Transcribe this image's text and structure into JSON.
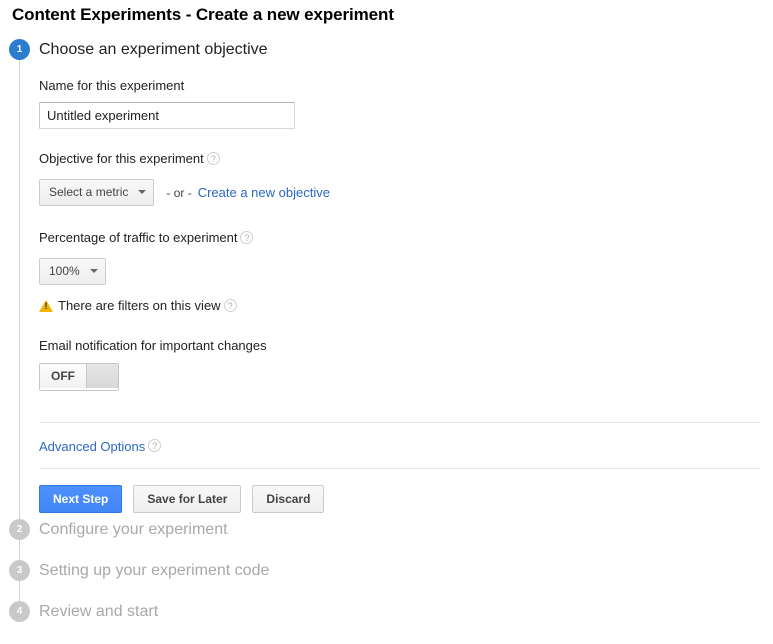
{
  "page": {
    "title": "Content Experiments - Create a new experiment"
  },
  "steps": [
    {
      "number": "1",
      "label": "Choose an experiment objective",
      "state": "active"
    },
    {
      "number": "2",
      "label": "Configure your experiment",
      "state": "inactive"
    },
    {
      "number": "3",
      "label": "Setting up your experiment code",
      "state": "inactive"
    },
    {
      "number": "4",
      "label": "Review and start",
      "state": "inactive"
    }
  ],
  "form": {
    "name_field": {
      "label": "Name for this experiment",
      "value": "Untitled experiment",
      "placeholder": "Untitled experiment"
    },
    "objective_field": {
      "label": "Objective for this experiment",
      "help": "?",
      "dropdown_value": "Select a metric",
      "or_text": "- or -",
      "create_link": "Create a new objective"
    },
    "traffic_field": {
      "label": "Percentage of traffic to experiment",
      "help": "?",
      "dropdown_value": "100%"
    },
    "filters_warning": {
      "icon": "warning-triangle-icon",
      "text": "There are filters on this view",
      "help": "?"
    },
    "email_field": {
      "label": "Email notification for important changes",
      "toggle_state": "OFF"
    },
    "advanced_options": {
      "label": "Advanced Options",
      "help": "?"
    }
  },
  "actions": {
    "next_step": "Next Step",
    "save_for_later": "Save for Later",
    "discard": "Discard"
  },
  "colors": {
    "accent_blue": "#2b7bcf",
    "link_blue": "#2b68c4",
    "button_blue": "#4285f4",
    "warning_yellow": "#f0b400",
    "inactive_gray": "#c9c9c9"
  }
}
